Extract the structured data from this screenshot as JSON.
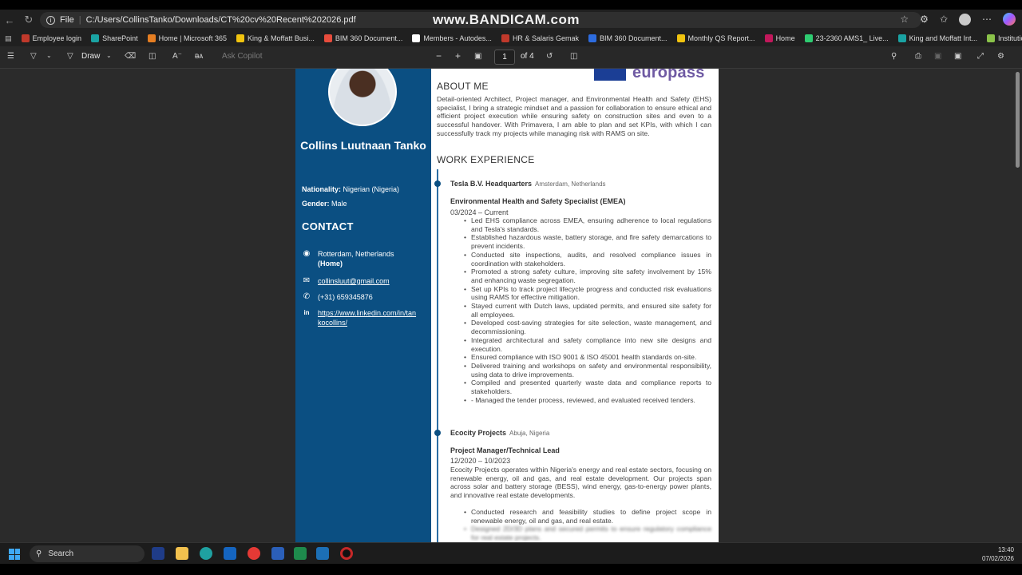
{
  "browser": {
    "file_label": "File",
    "url": "C:/Users/CollinsTanko/Downloads/CT%20cv%20Recent%202026.pdf",
    "watermark": "www.BANDICAM.com"
  },
  "bookmarks": [
    {
      "label": "Employee login",
      "color": "#c0392b"
    },
    {
      "label": "SharePoint",
      "color": "#1aa3a3"
    },
    {
      "label": "Home | Microsoft 365",
      "color": "#e67e22"
    },
    {
      "label": "King & Moffatt Busi...",
      "color": "#f1c40f"
    },
    {
      "label": "BIM 360 Document...",
      "color": "#e74c3c"
    },
    {
      "label": "Members - Autodes...",
      "color": "#ffffff"
    },
    {
      "label": "HR & Salaris Gemak",
      "color": "#c0392b"
    },
    {
      "label": "BIM 360 Document...",
      "color": "#2d6cdf"
    },
    {
      "label": "Monthly QS Report...",
      "color": "#f1c40f"
    },
    {
      "label": "Home",
      "color": "#c2185b"
    },
    {
      "label": "23-2360 AMS1_ Live...",
      "color": "#2ecc71"
    },
    {
      "label": "King and Moffatt Int...",
      "color": "#1aa3a3"
    },
    {
      "label": "Institutions - anabin...",
      "color": "#8bc34a"
    }
  ],
  "pdf_toolbar": {
    "draw_label": "Draw",
    "ask_copilot": "Ask Copilot",
    "page_current": "1",
    "page_total": "of 4"
  },
  "cv": {
    "name": "Collins Luutnaan Tanko",
    "nationality_label": "Nationality:",
    "nationality_value": "Nigerian (Nigeria)",
    "gender_label": "Gender:",
    "gender_value": "Male",
    "contact_heading": "CONTACT",
    "location": "Rotterdam, Netherlands",
    "location_tag": "(Home)",
    "email": "collinsluut@gmail.com",
    "phone": "(+31) 659345876",
    "linkedin": "https://www.linkedin.com/in/tankocollins/",
    "europass": "europass",
    "about_heading": "ABOUT ME",
    "about_text": "Detail-oriented Architect, Project manager, and Environmental Health and Safety (EHS) specialist, I bring a strategic mindset and a passion for collaboration to ensure ethical and efficient project execution while ensuring safety on construction sites and even to a successful handover. With Primavera, I am able to plan and set KPIs, with which I can successfully track my projects while managing risk with RAMS on site.",
    "work_heading": "WORK EXPERIENCE",
    "job1": {
      "company": "Tesla B.V. Headquarters",
      "location": "Amsterdam, Netherlands",
      "role": "Environmental Health and Safety Specialist (EMEA)",
      "dates": "03/2024 – Current",
      "bullets": [
        "Led EHS compliance across EMEA, ensuring adherence to local regulations and Tesla's standards.",
        "Established hazardous waste, battery storage, and fire safety demarcations to prevent incidents.",
        "Conducted site inspections, audits, and resolved compliance issues in coordination with stakeholders.",
        "Promoted a strong safety culture, improving site safety involvement by 15% and enhancing waste segregation.",
        "Set up KPIs to track project lifecycle progress and conducted risk evaluations using RAMS for effective mitigation.",
        "Stayed current with Dutch laws, updated permits, and ensured site safety for all employees.",
        "Developed cost-saving strategies for site selection, waste management, and decommissioning.",
        "Integrated architectural and safety compliance into new site designs and execution.",
        "Ensured compliance with ISO 9001 & ISO 45001 health standards on-site.",
        "Delivered training and workshops on safety and environmental responsibility, using data to drive improvements.",
        "Compiled and presented quarterly waste data and compliance reports to stakeholders.",
        "- Managed the tender process, reviewed, and evaluated received tenders."
      ]
    },
    "job2": {
      "company": "Ecocity Projects",
      "location": "Abuja, Nigeria",
      "role": "Project Manager/Technical Lead",
      "dates": "12/2020 – 10/2023",
      "description": "Ecocity Projects operates within Nigeria's energy and real estate sectors, focusing on renewable energy, oil and gas, and real estate development. Our projects span across solar and battery storage (BESS), wind energy, gas-to-energy power plants, and innovative real estate developments.",
      "bullets": [
        "Conducted research and feasibility studies to define project scope in renewable energy, oil and gas, and real estate.",
        "Designed 2D/3D plans and secured permits to ensure regulatory compliance for real estate projects."
      ]
    }
  },
  "taskbar": {
    "search_placeholder": "Search",
    "time": "13:40",
    "date": "07/02/2026"
  }
}
